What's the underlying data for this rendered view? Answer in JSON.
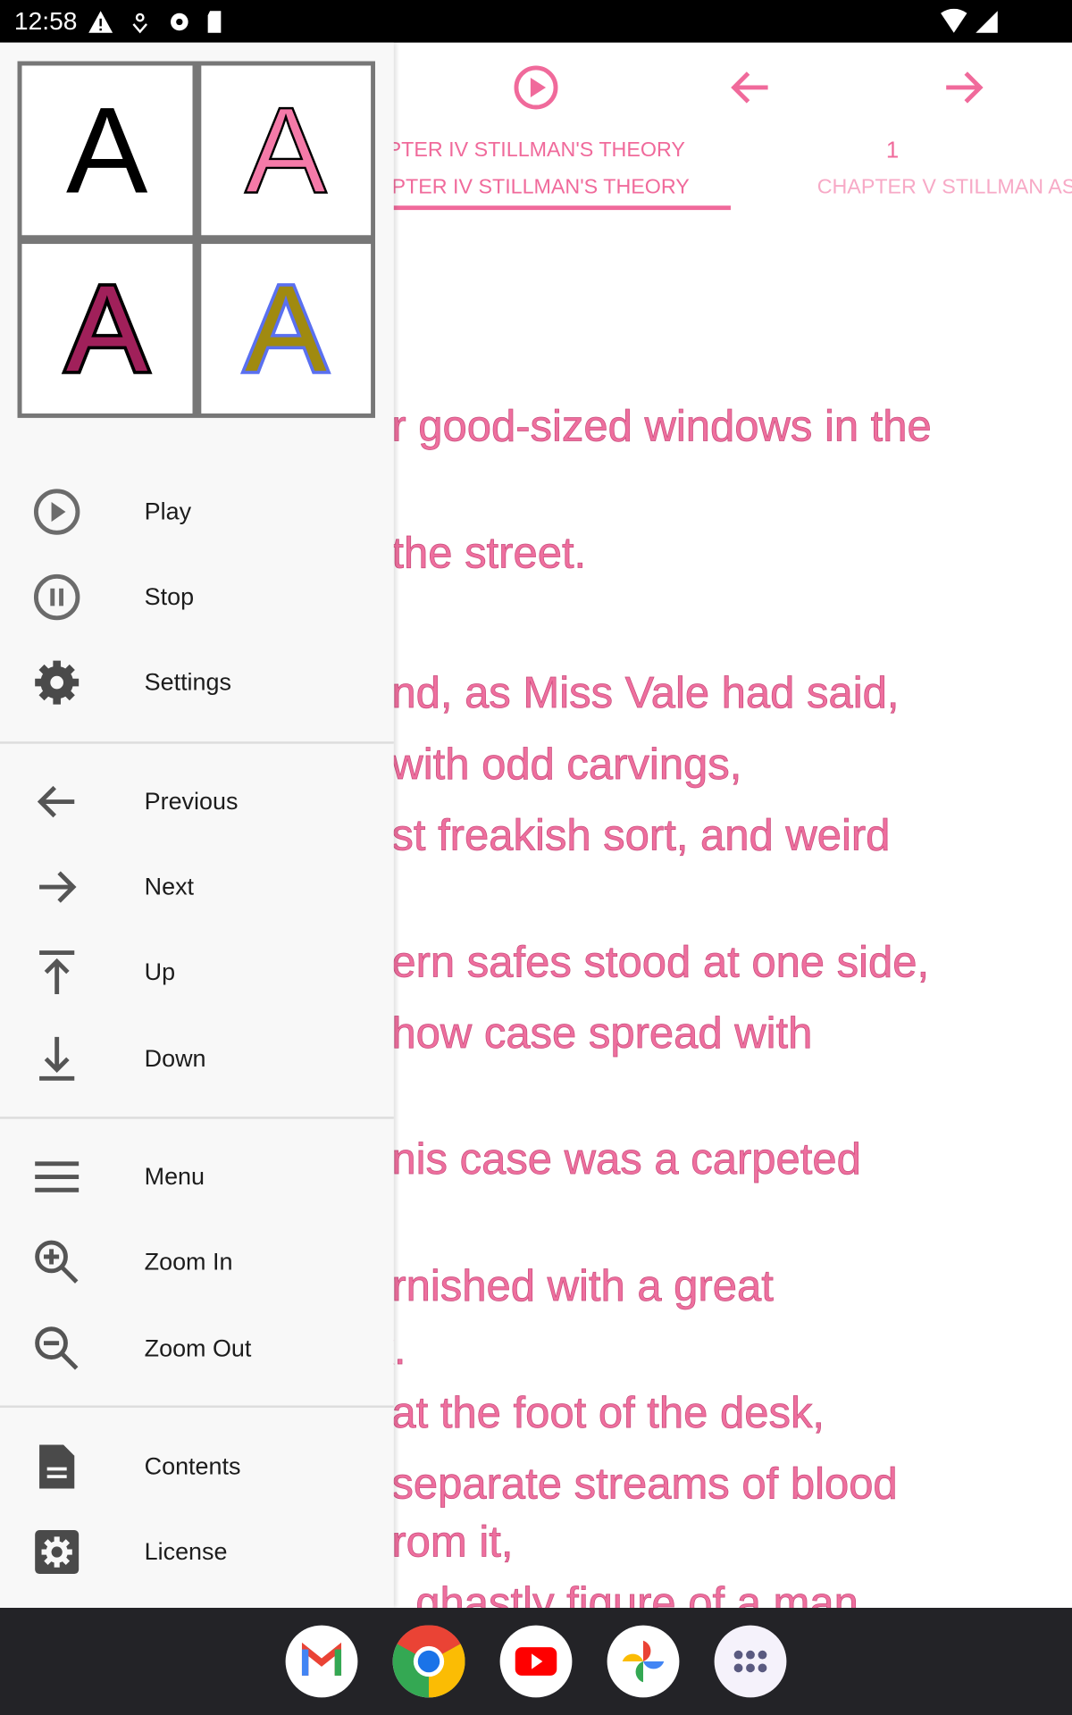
{
  "status_bar": {
    "time": "12:58",
    "icons": [
      "warning-icon",
      "download-icon",
      "gear-icon",
      "sd-card-icon",
      "wifi-icon",
      "signal-icon"
    ]
  },
  "toolbar": {
    "icons": [
      "play-circle-icon",
      "arrow-left-icon",
      "arrow-right-icon"
    ]
  },
  "tabs": {
    "current_title": "CHAPTER IV STILLMAN'S THEORY",
    "current_page": "1",
    "current_tab": "CHAPTER IV STILLMAN'S THEORY",
    "next_tab": "CHAPTER V STILLMAN AS"
  },
  "accent_color": "#f06a9b",
  "text_lines": [
    "r good-sized windows in the",
    "the street.",
    "nd, as Miss Vale had said,",
    " with odd carvings,",
    "st freakish sort, and weird",
    "ern safes stood at one side,",
    "how case spread with",
    "nis case was a carpeted",
    "rnished with a great",
    "k.",
    "at the foot of the desk,",
    "separate streams of blood",
    "rom it,",
    "ghastly figure of a man"
  ],
  "font_styles": {
    "letter": "A",
    "colors": [
      "#000000",
      "#f47aa8",
      "#a0205a",
      "#a08a10"
    ]
  },
  "drawer": {
    "items": [
      {
        "label": "Play",
        "icon": "play-circle-icon"
      },
      {
        "label": "Stop",
        "icon": "pause-circle-icon"
      },
      {
        "label": "Settings",
        "icon": "gear-icon"
      },
      {
        "label": "Previous",
        "icon": "arrow-left-icon"
      },
      {
        "label": "Next",
        "icon": "arrow-right-icon"
      },
      {
        "label": "Up",
        "icon": "arrow-up-bar-icon"
      },
      {
        "label": "Down",
        "icon": "arrow-down-bar-icon"
      },
      {
        "label": "Menu",
        "icon": "menu-icon"
      },
      {
        "label": "Zoom In",
        "icon": "zoom-in-icon"
      },
      {
        "label": "Zoom Out",
        "icon": "zoom-out-icon"
      },
      {
        "label": "Contents",
        "icon": "document-icon"
      },
      {
        "label": "License",
        "icon": "gear-box-icon"
      }
    ]
  },
  "dock": {
    "apps": [
      "Gmail",
      "Chrome",
      "YouTube",
      "Photos",
      "App drawer"
    ]
  }
}
